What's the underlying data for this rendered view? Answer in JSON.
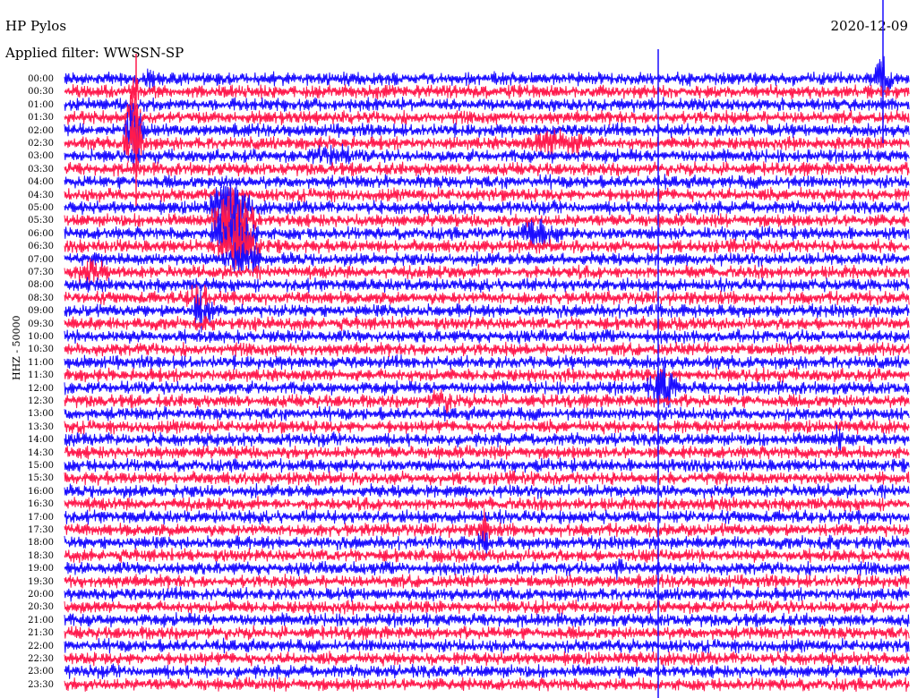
{
  "header": {
    "station": "HP Pylos",
    "filter": "Applied filter: WWSSN-SP",
    "date": "2020-12-09"
  },
  "axis": {
    "channel_label": "HHZ - 50000"
  },
  "time_labels": [
    "00:00",
    "00:30",
    "01:00",
    "01:30",
    "02:00",
    "02:30",
    "03:00",
    "03:30",
    "04:00",
    "04:30",
    "05:00",
    "05:30",
    "06:00",
    "06:30",
    "07:00",
    "07:30",
    "08:00",
    "08:30",
    "09:00",
    "09:30",
    "10:00",
    "10:30",
    "11:00",
    "11:30",
    "12:00",
    "12:30",
    "13:00",
    "13:30",
    "14:00",
    "14:30",
    "15:00",
    "15:30",
    "16:00",
    "16:30",
    "17:00",
    "17:30",
    "18:00",
    "18:30",
    "19:00",
    "19:30",
    "20:00",
    "20:30",
    "21:00",
    "21:30",
    "22:00",
    "22:30",
    "23:00",
    "23:30"
  ],
  "colors": {
    "trace_a": "#1a0dff",
    "trace_b": "#ff1a4d",
    "marker": "#1a0dff"
  }
}
